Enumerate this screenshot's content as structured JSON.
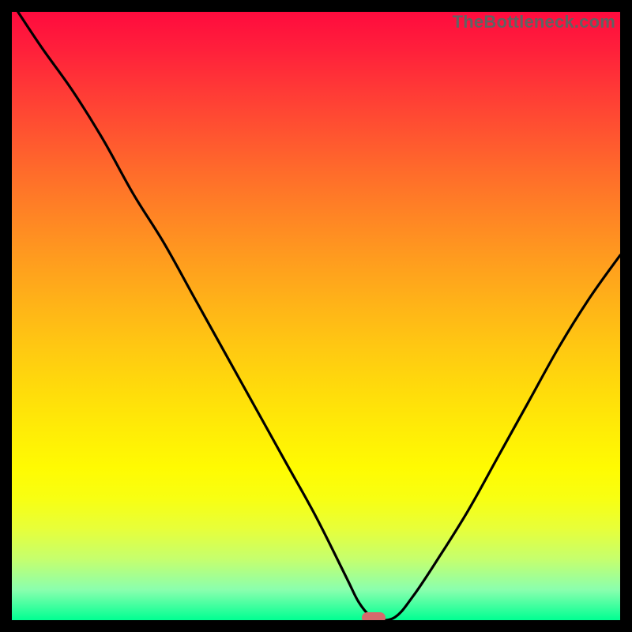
{
  "watermark": "TheBottleneck.com",
  "colors": {
    "frame": "#000000",
    "curve": "#000000",
    "marker": "#d66a6c",
    "gradient_top": "#ff0b3e",
    "gradient_bottom": "#00ff92"
  },
  "chart_data": {
    "type": "line",
    "title": "",
    "xlabel": "",
    "ylabel": "",
    "xlim": [
      0,
      100
    ],
    "ylim": [
      0,
      100
    ],
    "gradient_background": true,
    "series": [
      {
        "name": "bottleneck-curve",
        "x": [
          1,
          5,
          10,
          15,
          20,
          25,
          30,
          35,
          40,
          45,
          50,
          55,
          57,
          59,
          60,
          63,
          66,
          70,
          75,
          80,
          85,
          90,
          95,
          100
        ],
        "values": [
          100,
          94,
          87,
          79,
          70,
          62,
          53,
          44,
          35,
          26,
          17,
          7,
          3,
          0.5,
          0,
          0.5,
          4,
          10,
          18,
          27,
          36,
          45,
          53,
          60
        ]
      }
    ],
    "minimum_marker": {
      "x": 59.5,
      "y": 0
    },
    "annotations": [
      {
        "text": "TheBottleneck.com",
        "position": "top-right"
      }
    ]
  }
}
